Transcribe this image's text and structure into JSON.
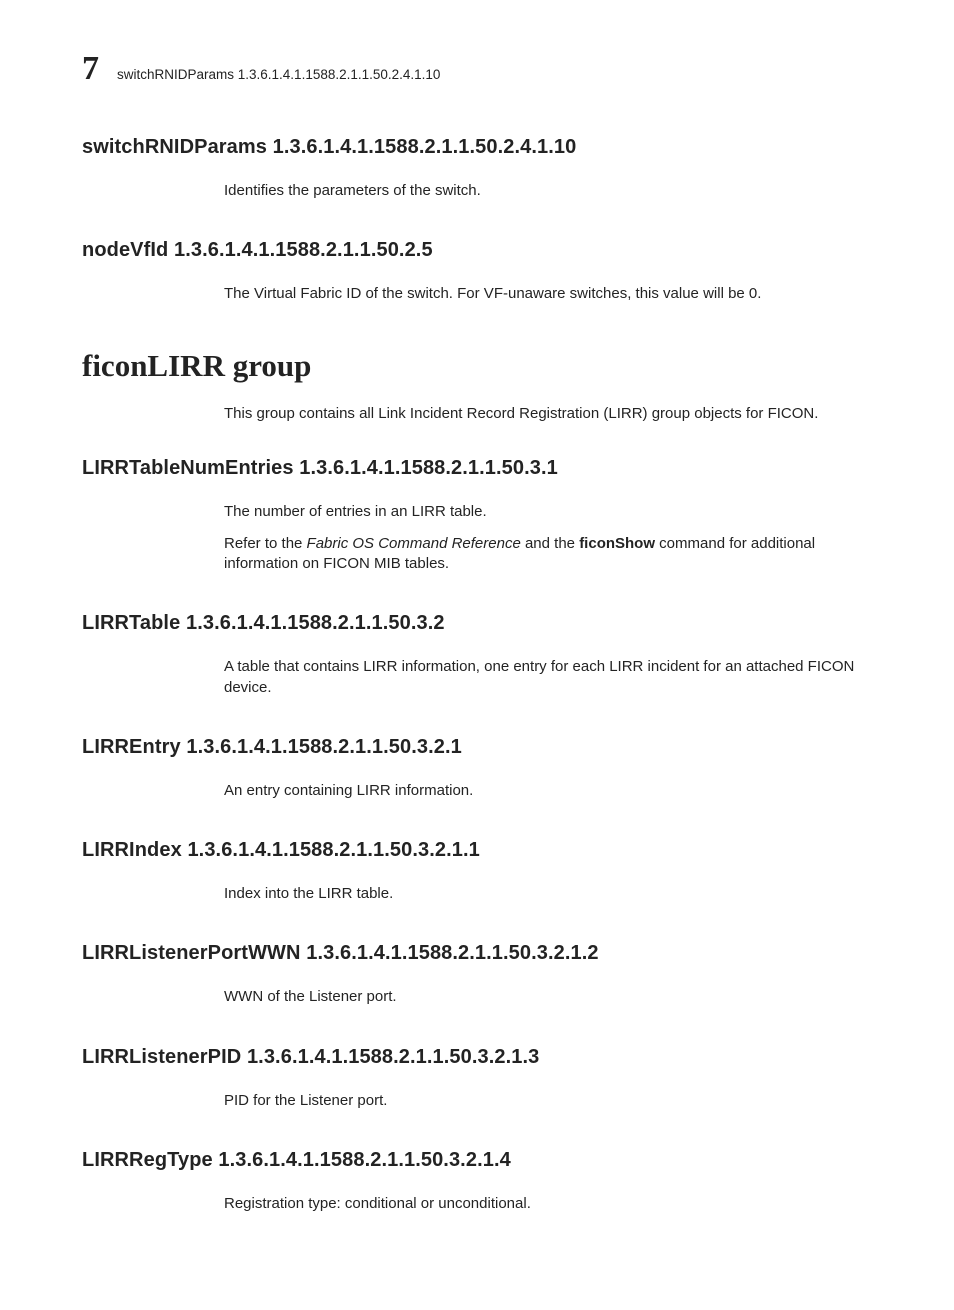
{
  "runningHead": {
    "chapterNumber": "7",
    "title": "switchRNIDParams 1.3.6.1.4.1.1588.2.1.1.50.2.4.1.10"
  },
  "sections": [
    {
      "key": "switchRNIDParams",
      "heading": "switchRNIDParams 1.3.6.1.4.1.1588.2.1.1.50.2.4.1.10",
      "paragraphs": [
        {
          "text": "Identifies the parameters of the switch."
        }
      ]
    },
    {
      "key": "nodeVfId",
      "heading": "nodeVfId 1.3.6.1.4.1.1588.2.1.1.50.2.5",
      "paragraphs": [
        {
          "text": "The Virtual Fabric ID of the switch. For VF-unaware switches, this value will be 0."
        }
      ]
    }
  ],
  "group": {
    "heading": "ficonLIRR group",
    "intro": "This group contains all Link Incident Record Registration (LIRR) group objects for FICON.",
    "sections": [
      {
        "key": "LIRRTableNumEntries",
        "heading": "LIRRTableNumEntries 1.3.6.1.4.1.1588.2.1.1.50.3.1",
        "paragraphs": [
          {
            "text": " The number of entries in an LIRR table."
          },
          {
            "prefix": "Refer to the ",
            "em": "Fabric OS Command Reference",
            "mid": " and the ",
            "bold": "ficonShow",
            "suffix": " command for additional information on FICON MIB tables."
          }
        ]
      },
      {
        "key": "LIRRTable",
        "heading": "LIRRTable 1.3.6.1.4.1.1588.2.1.1.50.3.2",
        "paragraphs": [
          {
            "text": "A table that contains LIRR information, one entry for each LIRR incident for an attached FICON device."
          }
        ]
      },
      {
        "key": "LIRREntry",
        "heading": "LIRREntry 1.3.6.1.4.1.1588.2.1.1.50.3.2.1",
        "paragraphs": [
          {
            "text": "An entry containing LIRR information."
          }
        ]
      },
      {
        "key": "LIRRIndex",
        "heading": "LIRRIndex 1.3.6.1.4.1.1588.2.1.1.50.3.2.1.1",
        "paragraphs": [
          {
            "text": "Index into the LIRR table."
          }
        ]
      },
      {
        "key": "LIRRListenerPortWWN",
        "heading": "LIRRListenerPortWWN 1.3.6.1.4.1.1588.2.1.1.50.3.2.1.2",
        "paragraphs": [
          {
            "text": "WWN of the Listener port."
          }
        ]
      },
      {
        "key": "LIRRListenerPID",
        "heading": "LIRRListenerPID 1.3.6.1.4.1.1588.2.1.1.50.3.2.1.3",
        "paragraphs": [
          {
            "text": "PID for the Listener port."
          }
        ]
      },
      {
        "key": "LIRRRegType",
        "heading": "LIRRRegType 1.3.6.1.4.1.1588.2.1.1.50.3.2.1.4",
        "paragraphs": [
          {
            "text": "Registration type: conditional or unconditional."
          }
        ]
      }
    ]
  }
}
